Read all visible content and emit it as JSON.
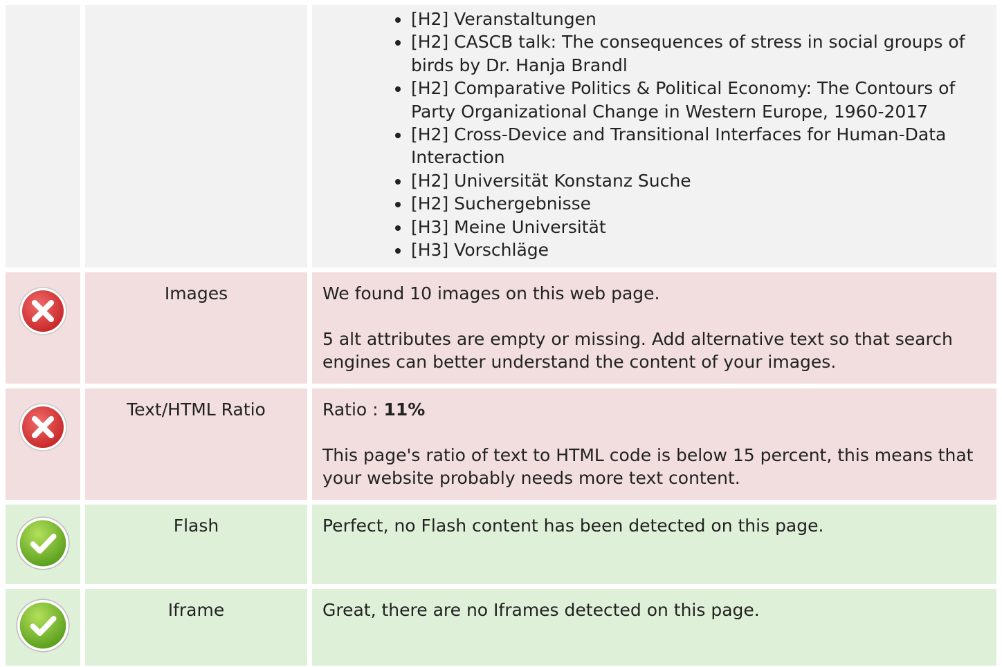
{
  "headings_row": {
    "items": [
      "[H2] Veranstaltungen",
      "[H2] CASCB talk: The consequences of stress in social groups of birds by Dr. Hanja Brandl",
      "[H2] Comparative Politics & Political Economy: The Contours of Party Organizational Change in Western Europe, 1960-2017",
      "[H2] Cross-Device and Transitional Interfaces for Human-Data Interaction",
      "[H2] Universität Konstanz Suche",
      "[H2] Suchergebnisse",
      "[H3] Meine Universität",
      "[H3] Vorschläge"
    ]
  },
  "images_row": {
    "status": "error",
    "label": "Images",
    "line1": "We found 10 images on this web page.",
    "line2": "5 alt attributes are empty or missing. Add alternative text so that search engines can better understand the content of your images."
  },
  "ratio_row": {
    "status": "error",
    "label": "Text/HTML Ratio",
    "ratio_prefix": "Ratio : ",
    "ratio_value": "11%",
    "line2": "This page's ratio of text to HTML code is below 15 percent, this means that your website probably needs more text content."
  },
  "flash_row": {
    "status": "ok",
    "label": "Flash",
    "line1": "Perfect, no Flash content has been detected on this page."
  },
  "iframe_row": {
    "status": "ok",
    "label": "Iframe",
    "line1": "Great, there are no Iframes detected on this page."
  },
  "colors": {
    "neutral_bg": "#f2f2f2",
    "error_bg": "#f2dede",
    "ok_bg": "#dff0d8",
    "error_icon": "#e03b3b",
    "ok_icon": "#7dbf2e"
  },
  "icons": {
    "error": "error-x-icon",
    "ok": "success-check-icon"
  }
}
